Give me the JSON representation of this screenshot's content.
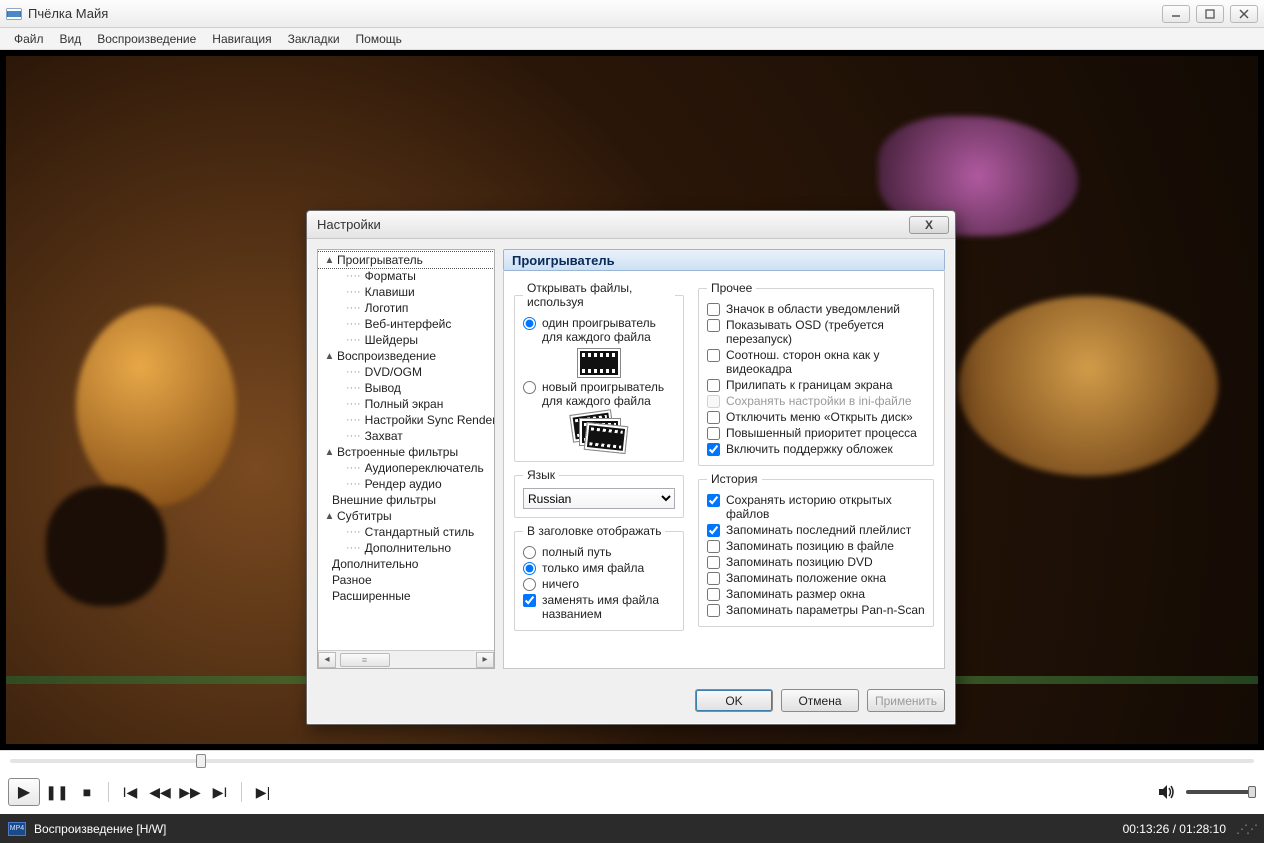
{
  "window": {
    "title": "Пчёлка Майя"
  },
  "menu": {
    "file": "Файл",
    "view": "Вид",
    "playback": "Воспроизведение",
    "nav": "Навигация",
    "bookmarks": "Закладки",
    "help": "Помощь"
  },
  "status": {
    "format": "MP4",
    "text": "Воспроизведение [H/W]",
    "time": "00:13:26 / 01:28:10"
  },
  "dialog": {
    "title": "Настройки",
    "section_header": "Проигрыватель",
    "buttons": {
      "ok": "OK",
      "cancel": "Отмена",
      "apply": "Применить"
    }
  },
  "tree": {
    "player": "Проигрыватель",
    "formats": "Форматы",
    "keys": "Клавиши",
    "logo": "Логотип",
    "web": "Веб-интерфейс",
    "shaders": "Шейдеры",
    "playback": "Воспроизведение",
    "dvd": "DVD/OGM",
    "output": "Вывод",
    "fullscreen": "Полный экран",
    "sync": "Настройки Sync Render",
    "capture": "Захват",
    "internal": "Встроенные фильтры",
    "audiosw": "Аудиопереключатель",
    "arender": "Рендер аудио",
    "external": "Внешние фильтры",
    "subs": "Субтитры",
    "std": "Стандартный стиль",
    "extra": "Дополнительно",
    "extra2": "Дополнительно",
    "misc": "Разное",
    "advanced": "Расширенные"
  },
  "open_group": {
    "legend": "Открывать файлы, используя",
    "one": "один проигрыватель для каждого файла",
    "new": "новый проигрыватель для каждого файла"
  },
  "lang_group": {
    "legend": "Язык",
    "value": "Russian"
  },
  "title_group": {
    "legend": "В заголовке отображать",
    "full": "полный путь",
    "name": "только имя файла",
    "none": "ничего",
    "replace": "заменять имя файла названием"
  },
  "other_group": {
    "legend": "Прочее",
    "tray": "Значок в области уведомлений",
    "osd": "Показывать OSD (требуется перезапуск)",
    "aspect": "Соотнош. сторон окна как у видеокадра",
    "snap": "Прилипать к границам экрана",
    "ini": "Сохранять настройки в ini-файле",
    "disable_open": "Отключить меню «Открыть диск»",
    "priority": "Повышенный приоритет процесса",
    "covers": "Включить поддержку обложек"
  },
  "history_group": {
    "legend": "История",
    "recent": "Сохранять историю открытых файлов",
    "playlist": "Запоминать последний плейлист",
    "filepos": "Запоминать позицию в файле",
    "dvdpos": "Запоминать позицию DVD",
    "winpos": "Запоминать положение окна",
    "winsize": "Запоминать размер окна",
    "pns": "Запоминать параметры Pan-n-Scan"
  }
}
